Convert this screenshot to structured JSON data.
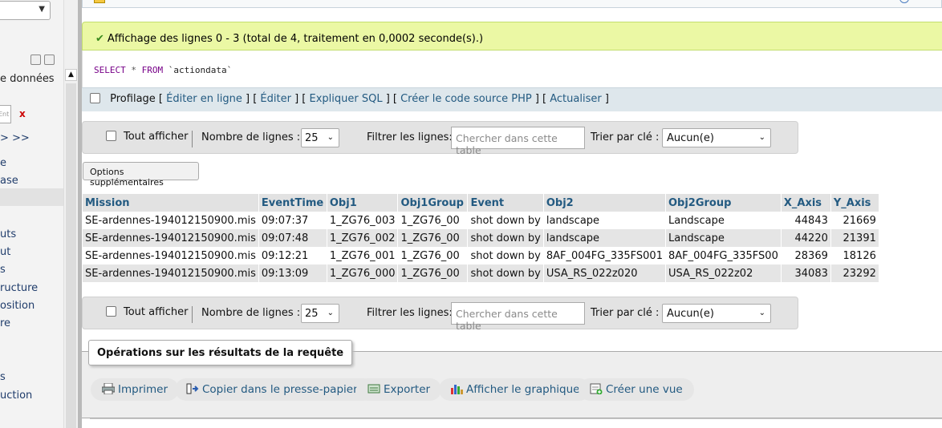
{
  "sidebar": {
    "label_databases": "e données",
    "filter_placeholder": "Ent",
    "filter_clear": "x",
    "items": [
      ">  >>",
      "e",
      "ase",
      "uts",
      "ut",
      "s",
      "ructure",
      "osition",
      "re",
      "s",
      "uction"
    ]
  },
  "status": {
    "message": "Affichage des lignes 0 - 3 (total de 4, traitement en 0,0002 seconde(s).)"
  },
  "sql": {
    "select": "SELECT",
    "star": "*",
    "from": "FROM",
    "table": "`actiondata`"
  },
  "profiling": {
    "label": "Profilage",
    "links": [
      "Éditer en ligne",
      "Éditer",
      "Expliquer SQL",
      "Créer le code source PHP",
      "Actualiser"
    ]
  },
  "navigation": {
    "show_all": "Tout afficher",
    "rows_label": "Nombre de lignes :",
    "rows_value": "25",
    "filter_label": "Filtrer les lignes:",
    "filter_placeholder": "Chercher dans cette table",
    "sort_label": "Trier par clé :",
    "sort_value": "Aucun(e)"
  },
  "options_button": "Options supplémentaires",
  "table": {
    "columns": [
      "Mission",
      "EventTime",
      "Obj1",
      "Obj1Group",
      "Event",
      "Obj2",
      "Obj2Group",
      "X_Axis",
      "Y_Axis"
    ],
    "rows": [
      [
        "SE-ardennes-194012150900.mis",
        "09:07:37",
        "1_ZG76_003",
        "1_ZG76_00",
        "shot down by",
        "landscape",
        "Landscape",
        "44843",
        "21669"
      ],
      [
        "SE-ardennes-194012150900.mis",
        "09:07:48",
        "1_ZG76_002",
        "1_ZG76_00",
        "shot down by",
        "landscape",
        "Landscape",
        "44220",
        "21391"
      ],
      [
        "SE-ardennes-194012150900.mis",
        "09:12:21",
        "1_ZG76_001",
        "1_ZG76_00",
        "shot down by",
        "8AF_004FG_335FS001",
        "8AF_004FG_335FS00",
        "28369",
        "18126"
      ],
      [
        "SE-ardennes-194012150900.mis",
        "09:13:09",
        "1_ZG76_000",
        "1_ZG76_00",
        "shot down by",
        "USA_RS_022z020",
        "USA_RS_022z02",
        "34083",
        "23292"
      ]
    ]
  },
  "operations": {
    "legend": "Opérations sur les résultats de la requête",
    "print": "Imprimer",
    "copy": "Copier dans le presse-papiers",
    "export": "Exporter",
    "chart": "Afficher le graphique",
    "view": "Créer une vue"
  },
  "colors": {
    "success_bg": "#ebf8a4",
    "link": "#235a81",
    "sql_keyword": "#770088"
  }
}
